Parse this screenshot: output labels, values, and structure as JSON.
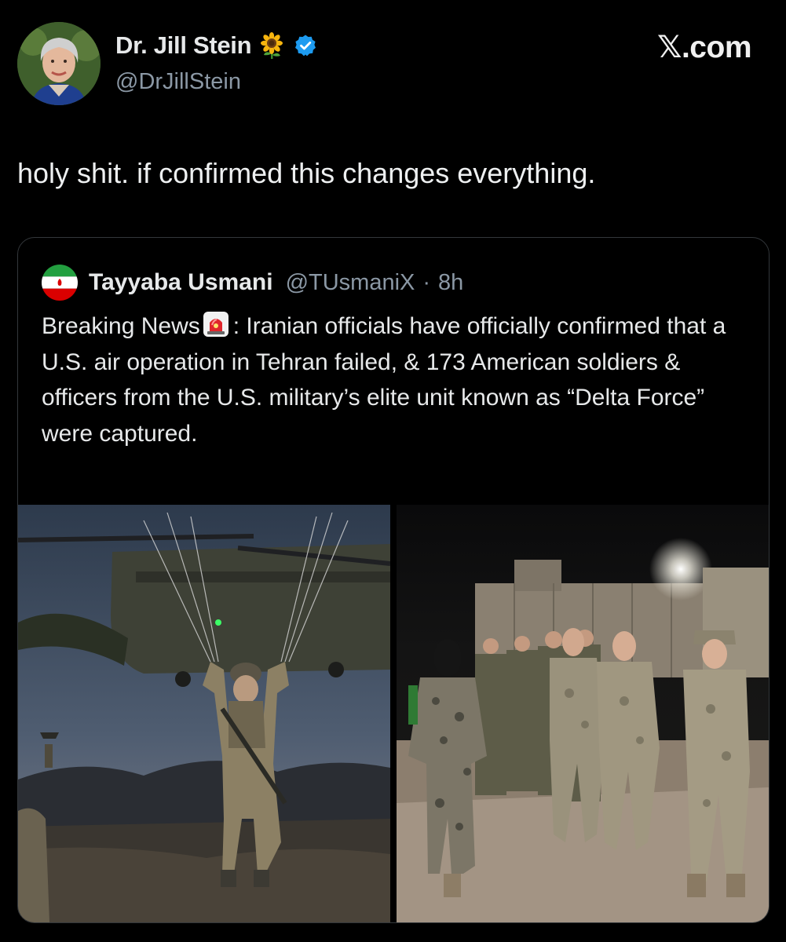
{
  "author": {
    "display_name": "Dr. Jill Stein",
    "handle": "@DrJillStein",
    "emoji_icon": "sunflower-icon",
    "verified_icon": "verified-badge-icon",
    "avatar_icon": "profile-photo"
  },
  "brand": {
    "label": "𝕏.com"
  },
  "tweet": {
    "text": "holy shit. if confirmed this changes everything."
  },
  "quoted_tweet": {
    "flag_icon": "iran-flag-icon",
    "display_name": "Tayyaba Usmani",
    "handle": "@TUsmaniX",
    "separator": "·",
    "time": "8h",
    "text_before_icon": "Breaking News",
    "inline_icon": "police-siren-icon",
    "text_after_icon": ": Iranian officials have officially confirmed that a U.S. air operation in Tehran failed, & 173 American soldiers & officers from the U.S. military’s elite unit known as “Delta Force” were captured.",
    "media": [
      {
        "icon": "parachute-soldier-photo"
      },
      {
        "icon": "marching-soldiers-photo"
      }
    ]
  },
  "colors": {
    "background": "#000000",
    "text_primary": "#e7e9ea",
    "text_secondary": "#8b98a5",
    "card_border": "#33373b",
    "verified_blue": "#1d9bf0"
  }
}
